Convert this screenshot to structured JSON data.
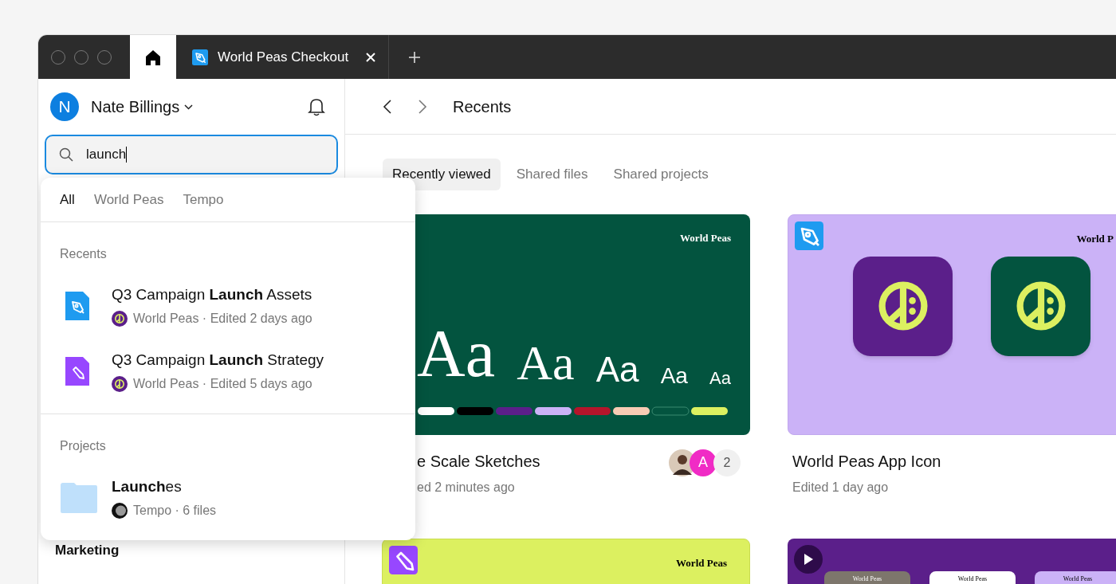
{
  "titlebar": {
    "tabs": [
      {
        "kind": "home",
        "selected": true
      },
      {
        "kind": "file",
        "label": "World Peas Checkout",
        "selected": false
      }
    ]
  },
  "sidebar": {
    "user": {
      "initial": "N",
      "name": "Nate Billings"
    },
    "search": {
      "value": "launch"
    },
    "sections": [
      {
        "title": "Marketing"
      }
    ]
  },
  "search_results": {
    "filters": [
      {
        "label": "All",
        "selected": true
      },
      {
        "label": "World Peas",
        "selected": false
      },
      {
        "label": "Tempo",
        "selected": false
      }
    ],
    "groups": [
      {
        "title": "Recents",
        "items": [
          {
            "kind": "design",
            "title": "Q3 Campaign **Launch** Assets",
            "team": {
              "kind": "peace",
              "name": "World Peas"
            },
            "meta": "· Edited 2 days ago"
          },
          {
            "kind": "board",
            "title": "Q3 Campaign **Launch** Strategy",
            "team": {
              "kind": "peace",
              "name": "World Peas"
            },
            "meta": "· Edited 5 days ago"
          }
        ]
      },
      {
        "title": "Projects",
        "items": [
          {
            "kind": "folder",
            "title": "**Launch**es",
            "team": {
              "kind": "shade",
              "name": "Tempo"
            },
            "meta": "· 6 files"
          }
        ]
      }
    ]
  },
  "main": {
    "title": "Recents",
    "tabs": [
      {
        "label": "Recently viewed",
        "selected": true
      },
      {
        "label": "Shared files",
        "selected": false
      },
      {
        "label": "Shared projects",
        "selected": false
      }
    ],
    "cards": [
      {
        "kind": "type_scale",
        "brand": "World Peas",
        "samples": [
          "Aa",
          "Aa",
          "Aa",
          "Aa",
          "Aa"
        ],
        "title": "e Scale Sketches",
        "subtitle": "ed 2 minutes ago",
        "avatar": "A",
        "more": "2"
      },
      {
        "kind": "app_icon",
        "brand": "World P",
        "title": "World Peas App Icon",
        "subtitle": "Edited 1 day ago"
      },
      {
        "kind": "board",
        "brand": "World Peas"
      },
      {
        "kind": "video",
        "screens": [
          "World Peas",
          "World Peas",
          "World Peas"
        ]
      }
    ]
  }
}
